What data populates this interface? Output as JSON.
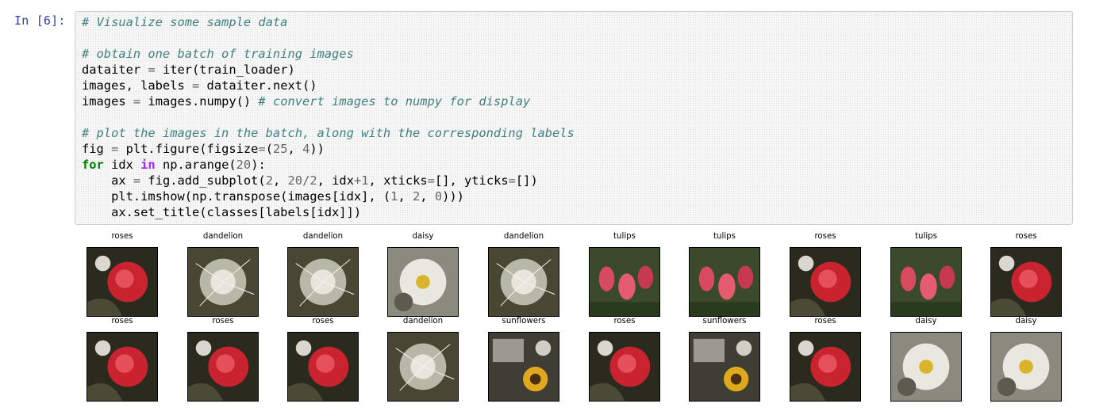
{
  "cell": {
    "prompt": "In [6]:",
    "code_lines": [
      "# Visualize some sample data",
      "",
      "# obtain one batch of training images",
      "dataiter = iter(train_loader)",
      "images, labels = dataiter.next()",
      "images = images.numpy() # convert images to numpy for display",
      "",
      "# plot the images in the batch, along with the corresponding labels",
      "fig = plt.figure(figsize=(25, 4))",
      "for idx in np.arange(20):",
      "    ax = fig.add_subplot(2, 20/2, idx+1, xticks=[], yticks=[])",
      "    plt.imshow(np.transpose(images[idx], (1, 2, 0)))",
      "    ax.set_title(classes[labels[idx]])"
    ]
  },
  "output": {
    "rows": [
      {
        "titles": [
          "roses",
          "dandelion",
          "dandelion",
          "daisy",
          "dandelion",
          "tulips",
          "tulips",
          "roses",
          "tulips",
          "roses"
        ],
        "images": [
          "roses-photo",
          "dandelion-photo",
          "dandelion-photo",
          "daisy-photo",
          "dandelion-photo",
          "tulips-photo",
          "tulips-photo",
          "roses-photo",
          "tulips-photo",
          "roses-photo"
        ]
      },
      {
        "titles": [
          "roses",
          "roses",
          "roses",
          "dandelion",
          "sunflowers",
          "roses",
          "sunflowers",
          "roses",
          "daisy",
          "daisy"
        ],
        "images": [
          "roses-photo",
          "roses-photo",
          "roses-photo",
          "dandelion-photo",
          "sunflowers-photo",
          "roses-photo",
          "sunflowers-photo",
          "roses-photo",
          "daisy-photo",
          "daisy-photo"
        ]
      }
    ]
  }
}
